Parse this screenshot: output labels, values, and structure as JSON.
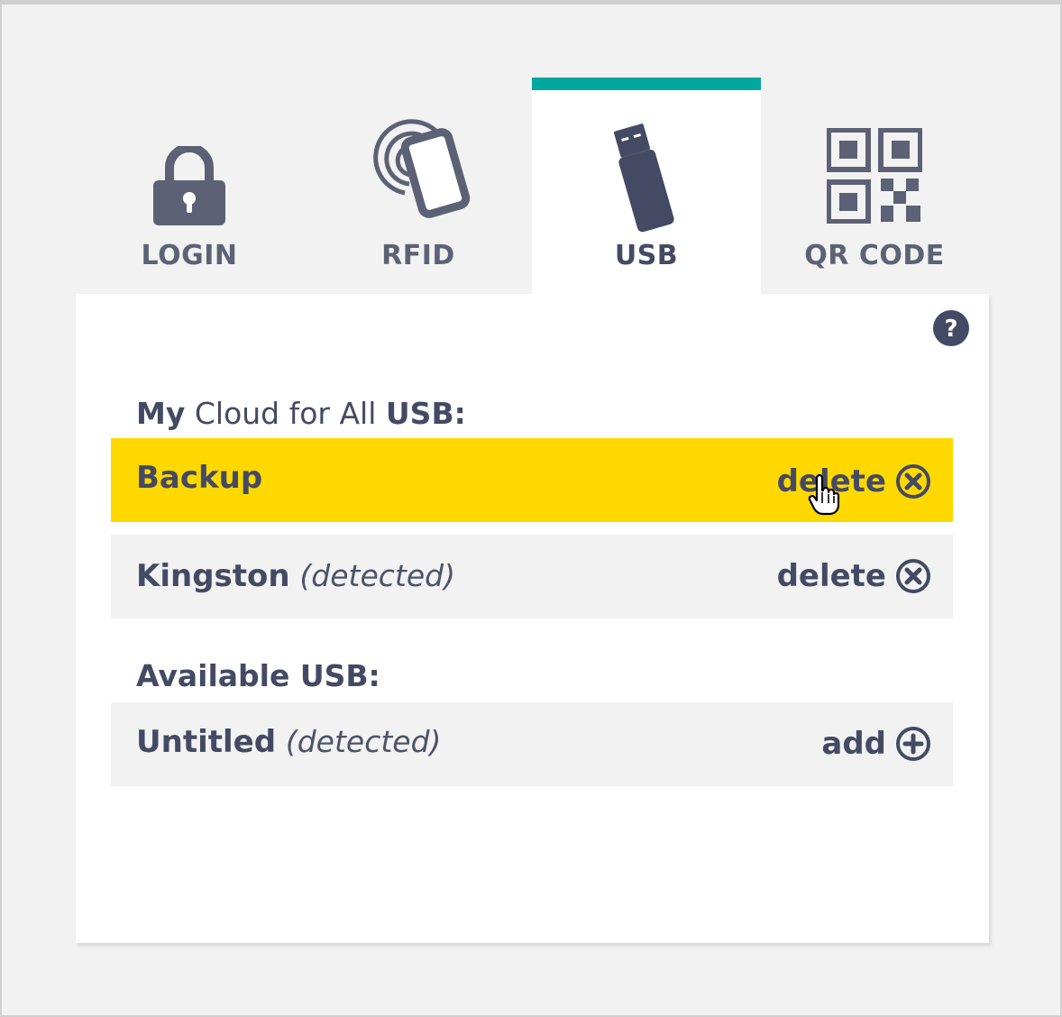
{
  "tabs": [
    {
      "id": "login",
      "label": "LOGIN",
      "icon": "lock-icon"
    },
    {
      "id": "rfid",
      "label": "RFID",
      "icon": "rfid-card-icon"
    },
    {
      "id": "usb",
      "label": "USB",
      "icon": "usb-drive-icon"
    },
    {
      "id": "qr",
      "label": "QR CODE",
      "icon": "qr-code-icon"
    }
  ],
  "active_tab": "usb",
  "colors": {
    "accent": "#00a79d",
    "highlight": "#ffd800",
    "text": "#444a63",
    "row_bg": "#f2f2f2"
  },
  "my_usb": {
    "title_bold_1": "My",
    "title_light": "Cloud for All",
    "title_bold_2": "USB:",
    "items": [
      {
        "name": "Backup",
        "note": "",
        "action": "delete",
        "highlighted": true
      },
      {
        "name": "Kingston",
        "note": "(detected)",
        "action": "delete",
        "highlighted": false
      }
    ]
  },
  "available_usb": {
    "title": "Available USB:",
    "items": [
      {
        "name": "Untitled",
        "note": "(detected)",
        "action": "add"
      }
    ]
  }
}
